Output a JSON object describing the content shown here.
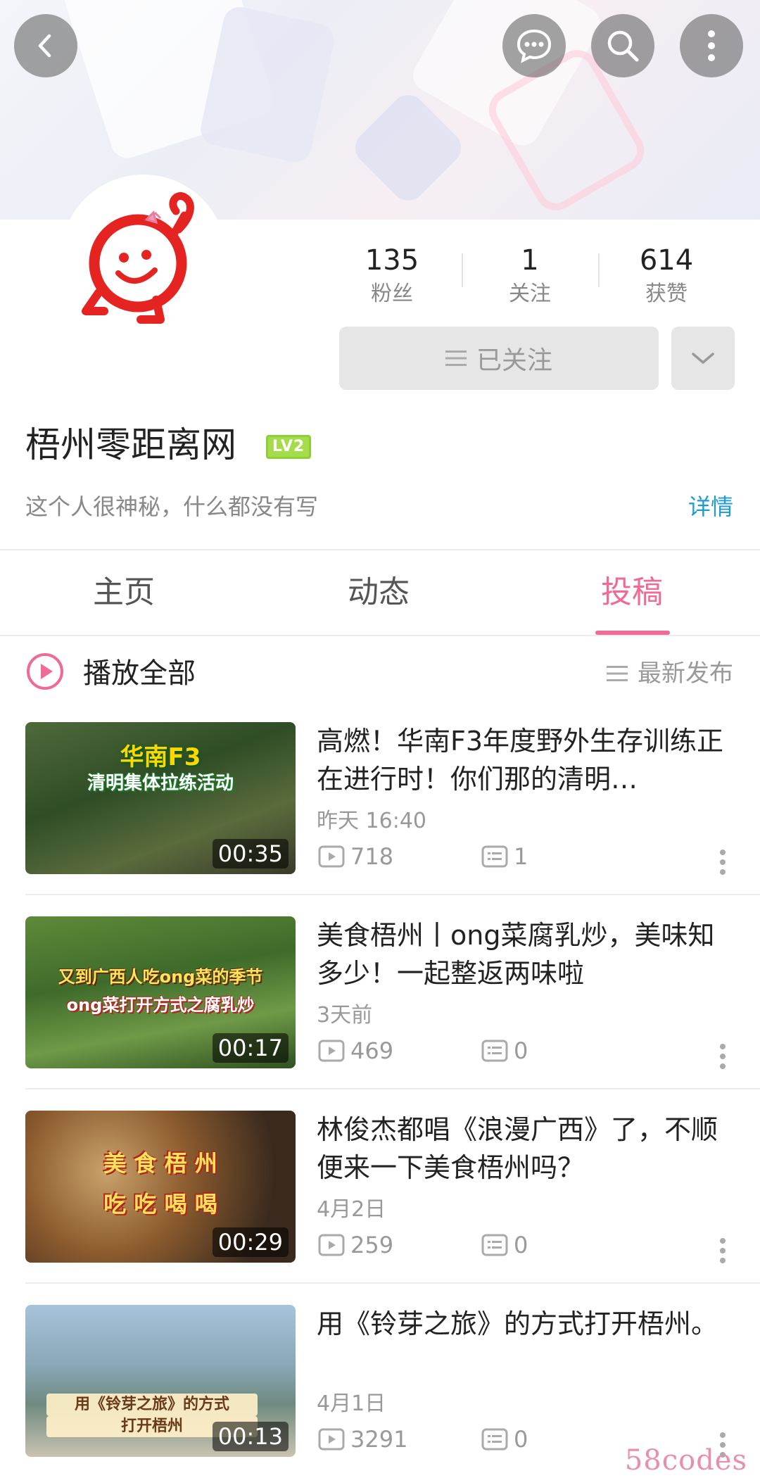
{
  "header": {
    "back_icon": "chevron-left-icon",
    "message_icon": "chat-bubble-icon",
    "search_icon": "search-icon",
    "more_icon": "vertical-dots-icon"
  },
  "profile": {
    "stats": [
      {
        "value": "135",
        "label": "粉丝"
      },
      {
        "value": "1",
        "label": "关注"
      },
      {
        "value": "614",
        "label": "获赞"
      }
    ],
    "follow_button": "已关注",
    "name": "梧州零距离网",
    "level": "LV2",
    "bio": "这个人很神秘，什么都没有写",
    "detail_link": "详情",
    "colors": {
      "accent": "#f06a96",
      "link": "#1e9bd1",
      "level_badge": "#a5dc4a"
    }
  },
  "tabs": [
    {
      "label": "主页",
      "active": false
    },
    {
      "label": "动态",
      "active": false
    },
    {
      "label": "投稿",
      "active": true
    }
  ],
  "list_header": {
    "play_all": "播放全部",
    "sort": "最新发布"
  },
  "videos": [
    {
      "title": "高燃！华南F3年度野外生存训练正在进行时！你们那的清明…",
      "time": "昨天 16:40",
      "plays": "718",
      "comments": "1",
      "duration": "00:35",
      "thumb_caption_1": "华南F3",
      "thumb_caption_2": "清明集体拉练活动"
    },
    {
      "title": "美食梧州丨ong菜腐乳炒，美味知多少！一起整返两味啦",
      "time": "3天前",
      "plays": "469",
      "comments": "0",
      "duration": "00:17",
      "thumb_caption_1": "又到广西人吃ong菜的季节",
      "thumb_caption_2": "ong菜打开方式之腐乳炒"
    },
    {
      "title": "林俊杰都唱《浪漫广西》了，不顺便来一下美食梧州吗？",
      "time": "4月2日",
      "plays": "259",
      "comments": "0",
      "duration": "00:29",
      "thumb_caption_1": "美 食 梧 州",
      "thumb_caption_2": "吃 吃 喝 喝"
    },
    {
      "title": "用《铃芽之旅》的方式打开梧州。",
      "time": "4月1日",
      "plays": "3291",
      "comments": "0",
      "duration": "00:13",
      "thumb_caption_1": "用《铃芽之旅》的方式",
      "thumb_caption_2": "打开梧州"
    }
  ],
  "watermark": "58codes"
}
